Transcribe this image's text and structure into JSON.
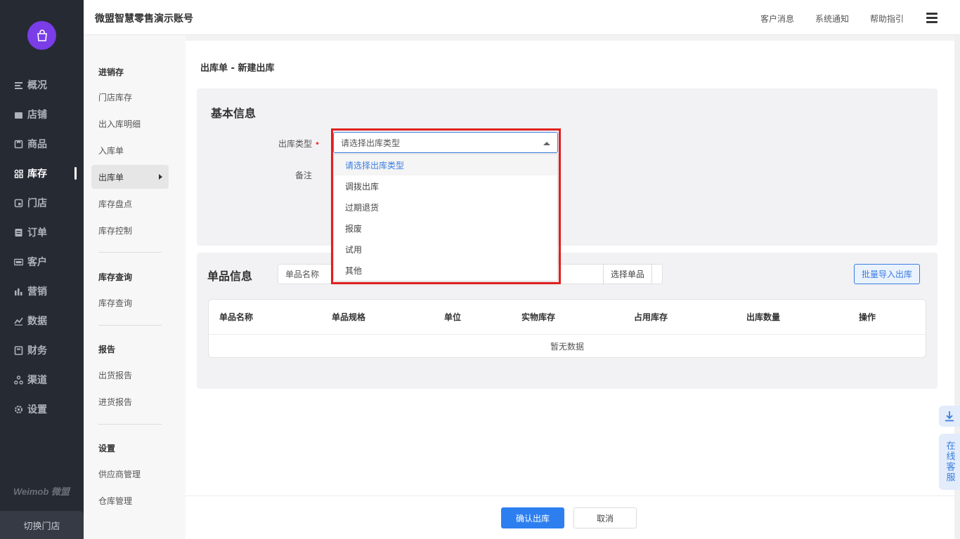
{
  "header": {
    "account_name": "微盟智慧零售演示账号",
    "links": [
      "客户消息",
      "系统通知",
      "帮助指引"
    ]
  },
  "nav": {
    "items": [
      {
        "label": "概况",
        "icon": "overview-icon"
      },
      {
        "label": "店铺",
        "icon": "shop-icon"
      },
      {
        "label": "商品",
        "icon": "goods-icon"
      },
      {
        "label": "库存",
        "icon": "inventory-icon"
      },
      {
        "label": "门店",
        "icon": "store-icon"
      },
      {
        "label": "订单",
        "icon": "order-icon"
      },
      {
        "label": "客户",
        "icon": "vip-icon"
      },
      {
        "label": "营销",
        "icon": "marketing-icon"
      },
      {
        "label": "数据",
        "icon": "data-icon"
      },
      {
        "label": "财务",
        "icon": "finance-icon"
      },
      {
        "label": "渠道",
        "icon": "channel-icon"
      },
      {
        "label": "设置",
        "icon": "settings-icon"
      }
    ],
    "active": "库存",
    "brand": "Weimob 微盟",
    "switch_store": "切换门店"
  },
  "subnav": {
    "group1": {
      "title": "进销存",
      "items": [
        "门店库存",
        "出入库明细",
        "入库单",
        "出库单",
        "库存盘点",
        "库存控制"
      ]
    },
    "group2": {
      "title": "库存查询",
      "items": [
        "库存查询"
      ]
    },
    "group3": {
      "title": "报告",
      "items": [
        "出货报告",
        "进货报告"
      ]
    },
    "group4": {
      "title": "设置",
      "items": [
        "供应商管理",
        "仓库管理"
      ]
    },
    "active": "出库单"
  },
  "main": {
    "breadcrumb": "出库单 - 新建出库",
    "basic_info": {
      "title": "基本信息",
      "type_label": "出库类型",
      "required_mark": "•",
      "select_value": "请选择出库类型",
      "remark_label": "备注",
      "options": [
        "请选择出库类型",
        "调拨出库",
        "过期退货",
        "报废",
        "试用",
        "其他"
      ]
    },
    "items_info": {
      "title": "单品信息",
      "search_placeholder": "单品名称",
      "pick_button": "选择单品",
      "import_button": "批量导入出库",
      "columns": [
        "单品名称",
        "单品规格",
        "单位",
        "实物库存",
        "占用库存",
        "出库数量",
        "操作"
      ],
      "empty_text": "暂无数据"
    }
  },
  "footer": {
    "confirm": "确认出库",
    "cancel": "取消"
  },
  "float": {
    "service": "在线客服"
  },
  "colors": {
    "primary": "#2d7ff0",
    "sidebar": "#262a33",
    "accent_purple": "#7a3de8",
    "highlight": "#e02020"
  }
}
